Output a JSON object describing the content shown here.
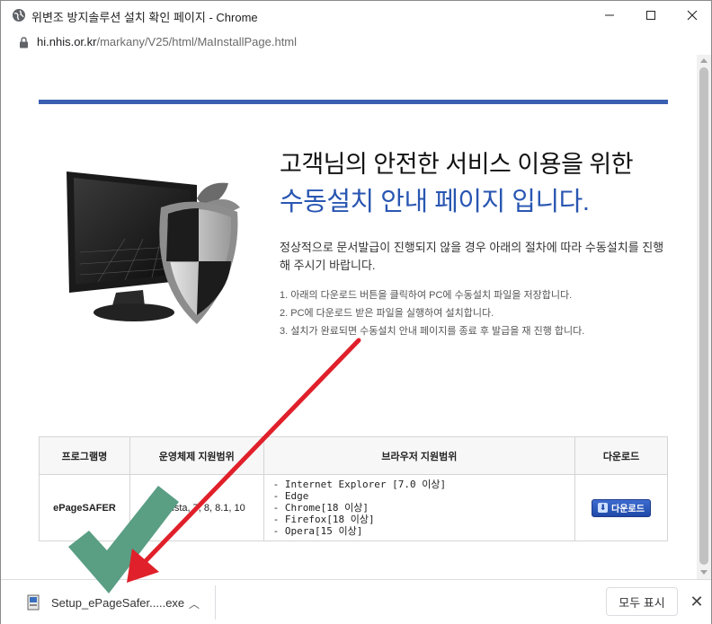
{
  "window": {
    "title": "위변조 방지솔루션 설치 확인 페이지 - Chrome",
    "url_host": "hi.nhis.or.kr",
    "url_path": "/markany/V25/html/MaInstallPage.html"
  },
  "hero": {
    "line1": "고객님의 안전한 서비스 이용을 위한",
    "line2": "수동설치 안내 페이지 입니다.",
    "description": "정상적으로 문서발급이 진행되지 않을 경우 아래의 절차에 따라 수동설치를 진행해 주시기 바랍니다.",
    "steps": [
      "1. 아래의 다운로드 버튼을 클릭하여 PC에 수동설치 파일을 저장합니다.",
      "2. PC에 다운로드 받은 파일을 실행하여 설치합니다.",
      "3. 설치가 완료되면 수동설치 안내 페이지를 종료 후 발급을 재 진행 합니다."
    ]
  },
  "table": {
    "headers": [
      "프로그램명",
      "운영체제 지원범위",
      "브라우저 지원범위",
      "다운로드"
    ],
    "row": {
      "program": "ePageSAFER",
      "os": "XP, Vista, 7, 8, 8.1, 10",
      "browsers": [
        "- Internet Explorer [7.0 이상]",
        "- Edge",
        "- Chrome[18 이상]",
        "- Firefox[18 이상]",
        "- Opera[15 이상]"
      ],
      "download_label": "다운로드"
    }
  },
  "download_bar": {
    "filename": "Setup_ePageSafer.....exe",
    "show_all_label": "모두 표시"
  },
  "colors": {
    "accent_blue": "#3b5fb0",
    "title_blue": "#2956b2",
    "arrow_red": "#e0202a",
    "check_green": "#5a9e84"
  }
}
